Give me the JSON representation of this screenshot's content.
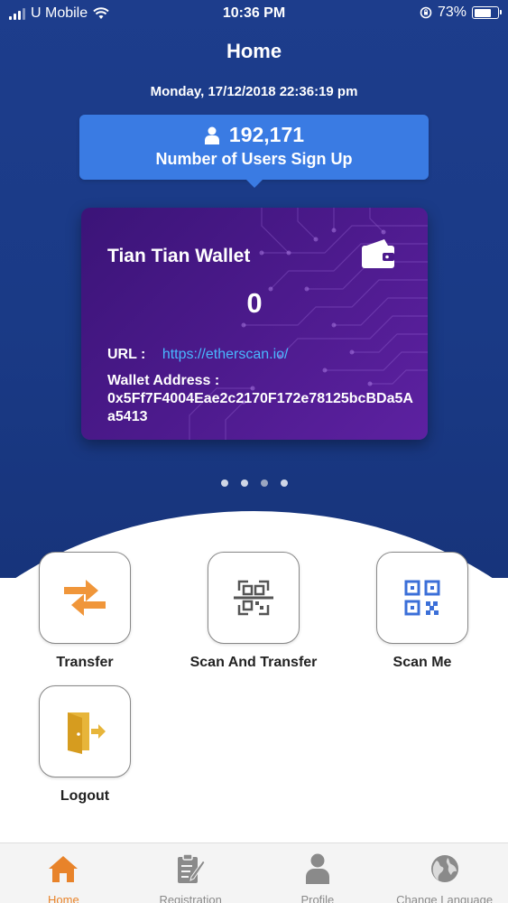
{
  "status_bar": {
    "carrier": "U Mobile",
    "time": "10:36 PM",
    "battery_text": "73%",
    "battery_level": 0.73,
    "icons": [
      "signal-icon",
      "wifi-icon",
      "rotation-lock-icon",
      "battery-icon"
    ]
  },
  "header": {
    "title": "Home",
    "datetime": "Monday, 17/12/2018 22:36:19 pm"
  },
  "users": {
    "count": "192,171",
    "label": "Number of Users Sign Up",
    "icon": "user-icon"
  },
  "wallet": {
    "name": "Tian Tian Wallet",
    "balance": "0",
    "url_label": "URL :",
    "url": "https://etherscan.io/",
    "address_label": "Wallet Address :",
    "address": "0x5Ff7F4004Eae2c2170F172e78125bcBDa5Aa5413",
    "icon": "wallet-icon"
  },
  "carousel": {
    "page_count": 4,
    "active_index": 2
  },
  "actions": [
    {
      "label": "Transfer",
      "icon": "transfer-arrows-icon"
    },
    {
      "label": "Scan And Transfer",
      "icon": "scan-qr-icon"
    },
    {
      "label": "Scan Me",
      "icon": "qr-code-icon"
    },
    {
      "label": "Logout",
      "icon": "logout-door-icon"
    }
  ],
  "tabs": [
    {
      "label": "Home",
      "icon": "home-icon",
      "active": true
    },
    {
      "label": "Registration",
      "icon": "registration-clipboard-icon",
      "active": false
    },
    {
      "label": "Profile",
      "icon": "profile-person-icon",
      "active": false
    },
    {
      "label": "Change Language",
      "icon": "globe-icon",
      "active": false
    }
  ],
  "colors": {
    "header_bg": "#1d3d8c",
    "banner_bg": "#3a7be3",
    "card_bg": "#4c1a8c",
    "link": "#49b7ff",
    "active_tab": "#e8832a",
    "transfer_icon": "#f0963a",
    "qr_icon": "#3b6fd8",
    "logout_icon": "#e7b53a"
  }
}
